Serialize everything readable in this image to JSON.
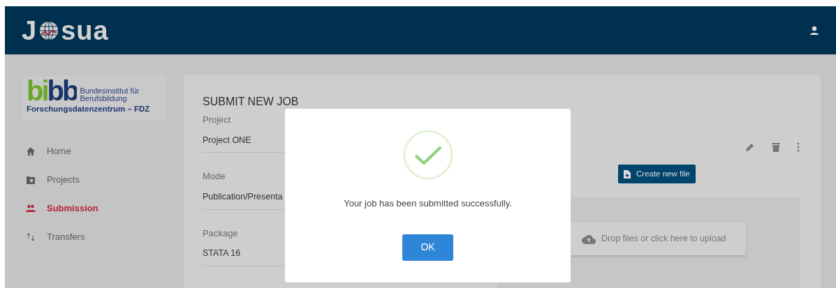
{
  "header": {
    "logo_left": "J",
    "logo_right": "sua"
  },
  "sidebar": {
    "logo": {
      "mark": "bibb",
      "line1": "Bundesinstitut für",
      "line2": "Berufsbildung",
      "line3": "Forschungsdatenzentrum – FDZ"
    },
    "items": [
      {
        "label": "Home",
        "selected": false
      },
      {
        "label": "Projects",
        "selected": false
      },
      {
        "label": "Submission",
        "selected": true
      },
      {
        "label": "Transfers",
        "selected": false
      }
    ]
  },
  "form": {
    "title": "SUBMIT NEW JOB",
    "fields": [
      {
        "label": "Project",
        "value": "Project ONE"
      },
      {
        "label": "Mode",
        "value": "Publication/Presenta"
      },
      {
        "label": "Package",
        "value": "STATA 16"
      }
    ],
    "create_button": "Create new file",
    "upload": "Drop files or click here to upload"
  },
  "dialog": {
    "message": "Your job has been submitted successfully.",
    "button": "OK"
  }
}
